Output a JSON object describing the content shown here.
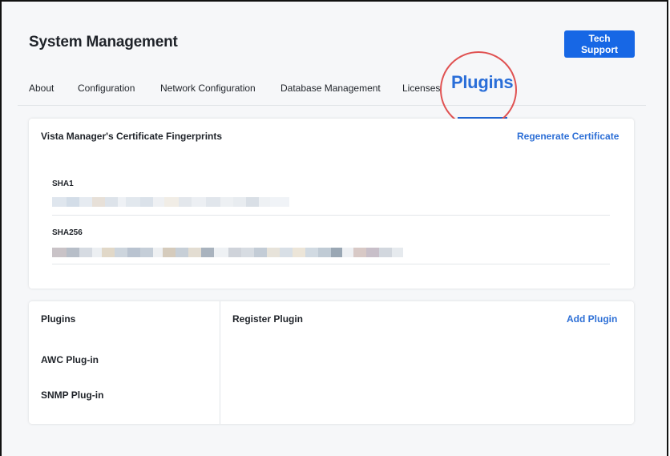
{
  "header": {
    "title": "System Management",
    "tech_support_label": "Tech Support"
  },
  "tabs": [
    {
      "label": "About"
    },
    {
      "label": "Configuration"
    },
    {
      "label": "Network Configuration"
    },
    {
      "label": "Database Management"
    },
    {
      "label": "Licenses"
    },
    {
      "label": "Plugins",
      "active": true
    }
  ],
  "certificate": {
    "title": "Vista Manager's Certificate Fingerprints",
    "regenerate_label": "Regenerate Certificate",
    "sha1_label": "SHA1",
    "sha256_label": "SHA256"
  },
  "plugins_panel": {
    "title": "Plugins",
    "items": [
      {
        "label": "AWC Plug-in"
      },
      {
        "label": "SNMP Plug-in"
      }
    ]
  },
  "register_panel": {
    "title": "Register Plugin",
    "add_label": "Add Plugin"
  },
  "colors": {
    "accent": "#1767e5",
    "link": "#2d6fd6",
    "highlight_circle": "#e05252"
  }
}
